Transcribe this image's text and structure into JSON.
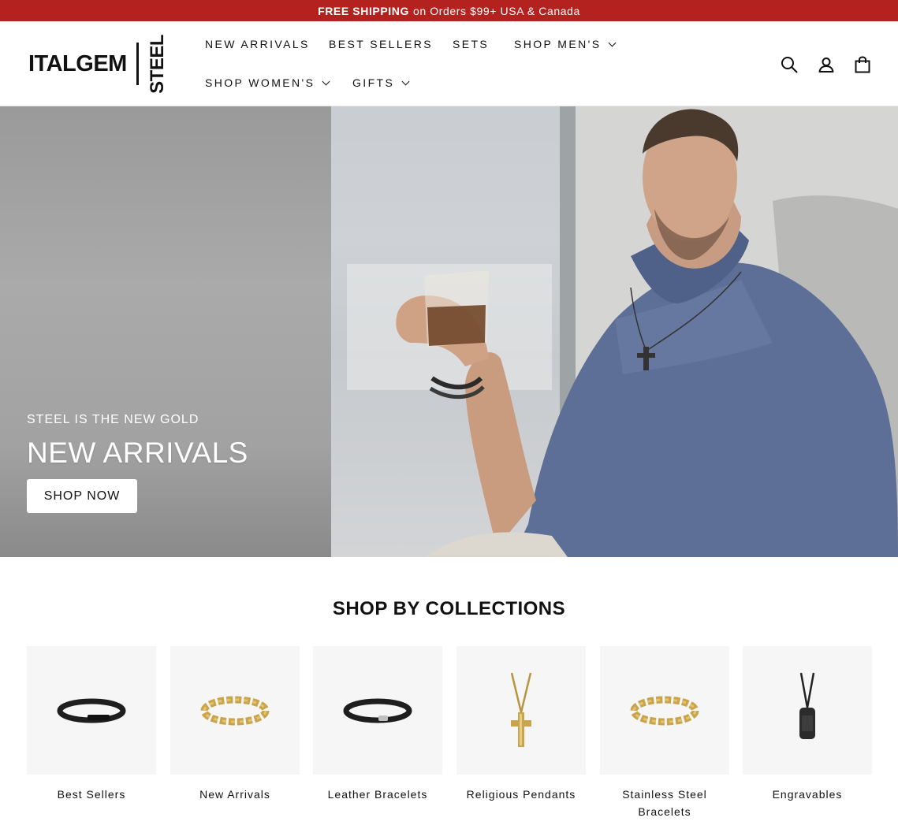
{
  "announcement": {
    "bold": "FREE SHIPPING",
    "rest": "on Orders $99+ USA & Canada"
  },
  "header": {
    "logo": {
      "word": "ITALGEM",
      "vertical": "STEEL"
    },
    "nav": [
      {
        "label": "NEW ARRIVALS"
      },
      {
        "label": "BEST SELLERS"
      },
      {
        "label": "SETS"
      },
      {
        "label": "SHOP MEN'S"
      },
      {
        "label": "SHOP WOMEN'S"
      },
      {
        "label": "GIFTS"
      }
    ],
    "icons": [
      "search-icon",
      "account-icon",
      "cart-icon"
    ]
  },
  "hero": {
    "kicker": "STEEL IS THE NEW GOLD",
    "title": "NEW ARRIVALS",
    "button": "SHOP NOW"
  },
  "collections": {
    "title": "SHOP BY COLLECTIONS",
    "items": [
      {
        "label": "Best Sellers",
        "icon": "black-bracelet-icon"
      },
      {
        "label": "New Arrivals",
        "icon": "gold-chain-icon"
      },
      {
        "label": "Leather Bracelets",
        "icon": "leather-bracelet-icon"
      },
      {
        "label": "Religious Pendants",
        "icon": "cross-pendant-icon"
      },
      {
        "label": "Stainless Steel Bracelets",
        "icon": "gold-chain-icon"
      },
      {
        "label": "Engravables",
        "icon": "dog-tag-icon"
      }
    ]
  },
  "colors": {
    "announcement_bg": "#b3221e",
    "text": "#111111",
    "card_bg": "#f6f6f6"
  }
}
